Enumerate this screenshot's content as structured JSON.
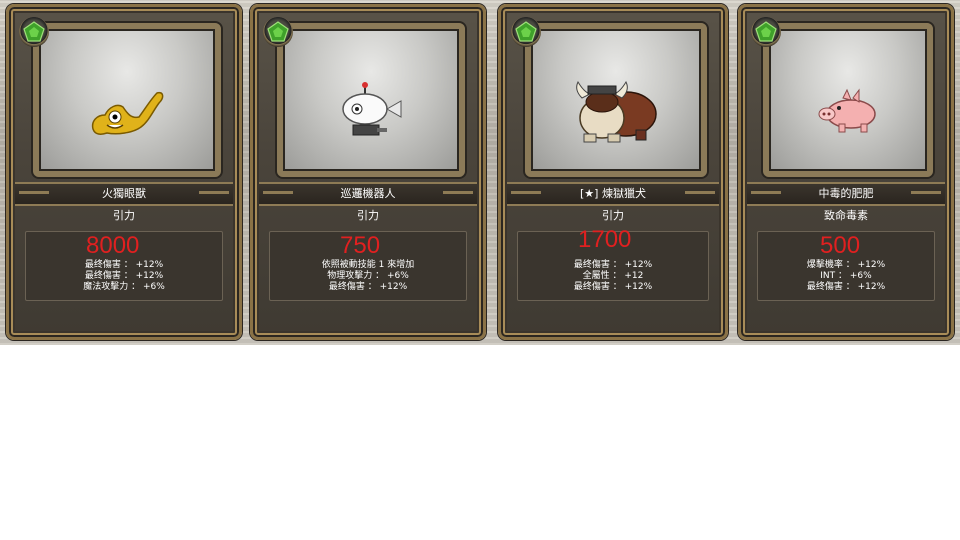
{
  "cards": [
    {
      "name": "火獨眼獸",
      "ability": "引力",
      "points": "8000",
      "stats": [
        "最终傷害 ： +12%",
        "最终傷害 ： +12%",
        "魔法攻擊力 ： +6%"
      ],
      "monster_icon": "yellow-lizard-icon"
    },
    {
      "name": "巡邏機器人",
      "ability": "引力",
      "points": "750",
      "stats": [
        "依照被動技能 1 來增加",
        "物理攻擊力 ： +6%",
        "最终傷害 ： +12%"
      ],
      "monster_icon": "patrol-robot-icon"
    },
    {
      "name": "[★] 煉獄獵犬",
      "ability": "引力",
      "points": "1700",
      "stats": [
        "最终傷害 ： +12%",
        "全屬性 ： +12",
        "最终傷害 ： +12%"
      ],
      "monster_icon": "horned-hellhound-icon"
    },
    {
      "name": "中毒的肥肥",
      "ability": "致命毒素",
      "points": "500",
      "stats": [
        "爆擊機率 ： +12%",
        "INT ： +6%",
        "最终傷害 ： +12%"
      ],
      "monster_icon": "pink-pig-icon"
    }
  ],
  "colors": {
    "points": "#e02020",
    "frame": "#8a7246",
    "gem": "#3fa12a"
  }
}
